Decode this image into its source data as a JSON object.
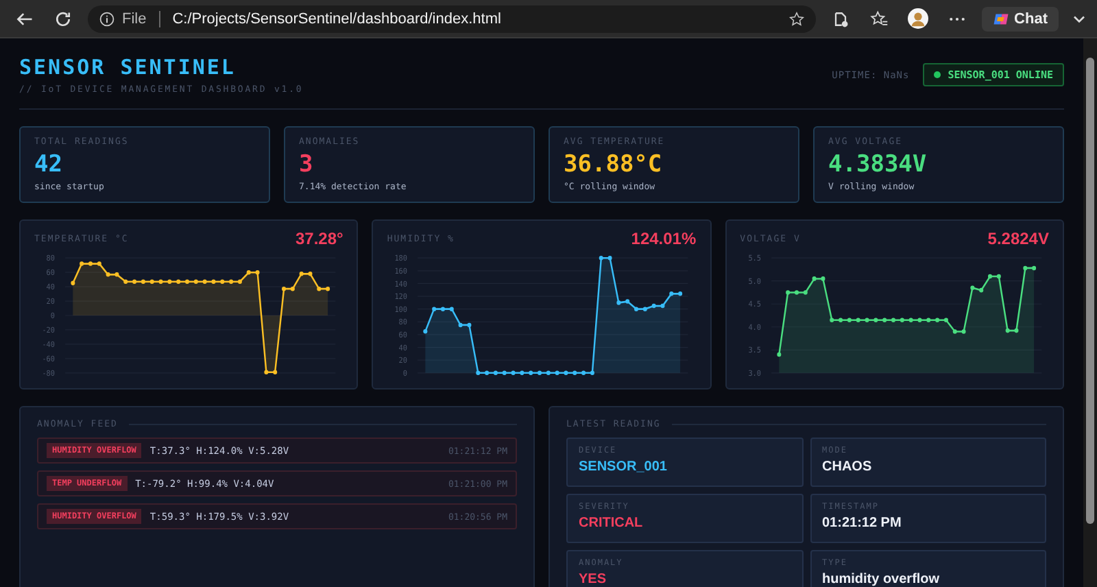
{
  "browser": {
    "file_label": "File",
    "url": "C:/Projects/SensorSentinel/dashboard/index.html",
    "chat_label": "Chat"
  },
  "header": {
    "title": "SENSOR SENTINEL",
    "subtitle": "// IoT DEVICE MANAGEMENT DASHBOARD v1.0",
    "uptime": "UPTIME: NaNs",
    "device_status": "SENSOR_001 ONLINE"
  },
  "stats": [
    {
      "label": "TOTAL READINGS",
      "value": "42",
      "note": "since startup",
      "color": "#38bdf8"
    },
    {
      "label": "ANOMALIES",
      "value": "3",
      "note": "7.14% detection rate",
      "color": "#f43f5e"
    },
    {
      "label": "AVG TEMPERATURE",
      "value": "36.88°C",
      "note": "°C rolling window",
      "color": "#fbbf24"
    },
    {
      "label": "AVG VOLTAGE",
      "value": "4.3834V",
      "note": "V rolling window",
      "color": "#4ade80"
    }
  ],
  "charts": [
    {
      "current": "37.28°",
      "chart_data": {
        "type": "area",
        "title": "TEMPERATURE °C",
        "grid": true,
        "series": [
          {
            "color": "#fbbf24",
            "values": [
              45,
              72,
              72,
              72,
              57,
              57,
              47,
              47,
              47,
              47,
              47,
              47,
              47,
              47,
              47,
              47,
              47,
              47,
              47,
              47,
              60,
              60,
              -79,
              -79,
              37,
              37,
              58,
              58,
              37,
              37
            ]
          }
        ],
        "ylim": [
          -80,
          80
        ],
        "yticks": [
          80,
          60,
          40,
          20,
          0,
          -20,
          -40,
          -60,
          -80
        ]
      }
    },
    {
      "current": "124.01%",
      "chart_data": {
        "type": "area",
        "title": "HUMIDITY %",
        "grid": true,
        "series": [
          {
            "color": "#38bdf8",
            "values": [
              65,
              100,
              100,
              100,
              75,
              75,
              0,
              0,
              0,
              0,
              0,
              0,
              0,
              0,
              0,
              0,
              0,
              0,
              0,
              0,
              180,
              180,
              110,
              112,
              100,
              100,
              105,
              105,
              124,
              124
            ]
          }
        ],
        "ylim": [
          0,
          180
        ],
        "yticks": [
          180,
          160,
          140,
          120,
          100,
          80,
          60,
          40,
          20,
          0
        ]
      }
    },
    {
      "current": "5.2824V",
      "chart_data": {
        "type": "area",
        "title": "VOLTAGE V",
        "grid": true,
        "series": [
          {
            "color": "#4ade80",
            "values": [
              3.4,
              4.75,
              4.75,
              4.75,
              5.05,
              5.05,
              4.15,
              4.15,
              4.15,
              4.15,
              4.15,
              4.15,
              4.15,
              4.15,
              4.15,
              4.15,
              4.15,
              4.15,
              4.15,
              4.15,
              3.9,
              3.9,
              4.85,
              4.8,
              5.1,
              5.1,
              3.92,
              3.92,
              5.28,
              5.28
            ]
          }
        ],
        "ylim": [
          3,
          5.5
        ],
        "yticks": [
          {
            "value": 5.5,
            "label": "5.5"
          },
          {
            "value": 5,
            "label": "5.0"
          },
          {
            "value": 4.5,
            "label": "4.5"
          },
          {
            "value": 4,
            "label": "4.0"
          },
          {
            "value": 3.5,
            "label": "3.5"
          },
          {
            "value": 3,
            "label": "3.0"
          }
        ]
      }
    }
  ],
  "anomaly_feed": {
    "title": "ANOMALY FEED",
    "items": [
      {
        "tag": "HUMIDITY OVERFLOW",
        "reading": "T:37.3° H:124.0% V:5.28V",
        "time": "01:21:12 PM"
      },
      {
        "tag": "TEMP UNDERFLOW",
        "reading": "T:-79.2° H:99.4% V:4.04V",
        "time": "01:21:00 PM"
      },
      {
        "tag": "HUMIDITY OVERFLOW",
        "reading": "T:59.3° H:179.5% V:3.92V",
        "time": "01:20:56 PM"
      }
    ]
  },
  "latest_reading": {
    "title": "LATEST READING",
    "fields": [
      {
        "label": "DEVICE",
        "value": "SENSOR_001",
        "color": "#38bdf8"
      },
      {
        "label": "MODE",
        "value": "CHAOS",
        "color": "#eef1f8"
      },
      {
        "label": "SEVERITY",
        "value": "CRITICAL",
        "color": "#f43f5e"
      },
      {
        "label": "TIMESTAMP",
        "value": "01:21:12 PM",
        "color": "#eef1f8"
      },
      {
        "label": "ANOMALY",
        "value": "YES",
        "color": "#f43f5e"
      },
      {
        "label": "TYPE",
        "value": "humidity overflow",
        "color": "#eef1f8"
      }
    ]
  }
}
